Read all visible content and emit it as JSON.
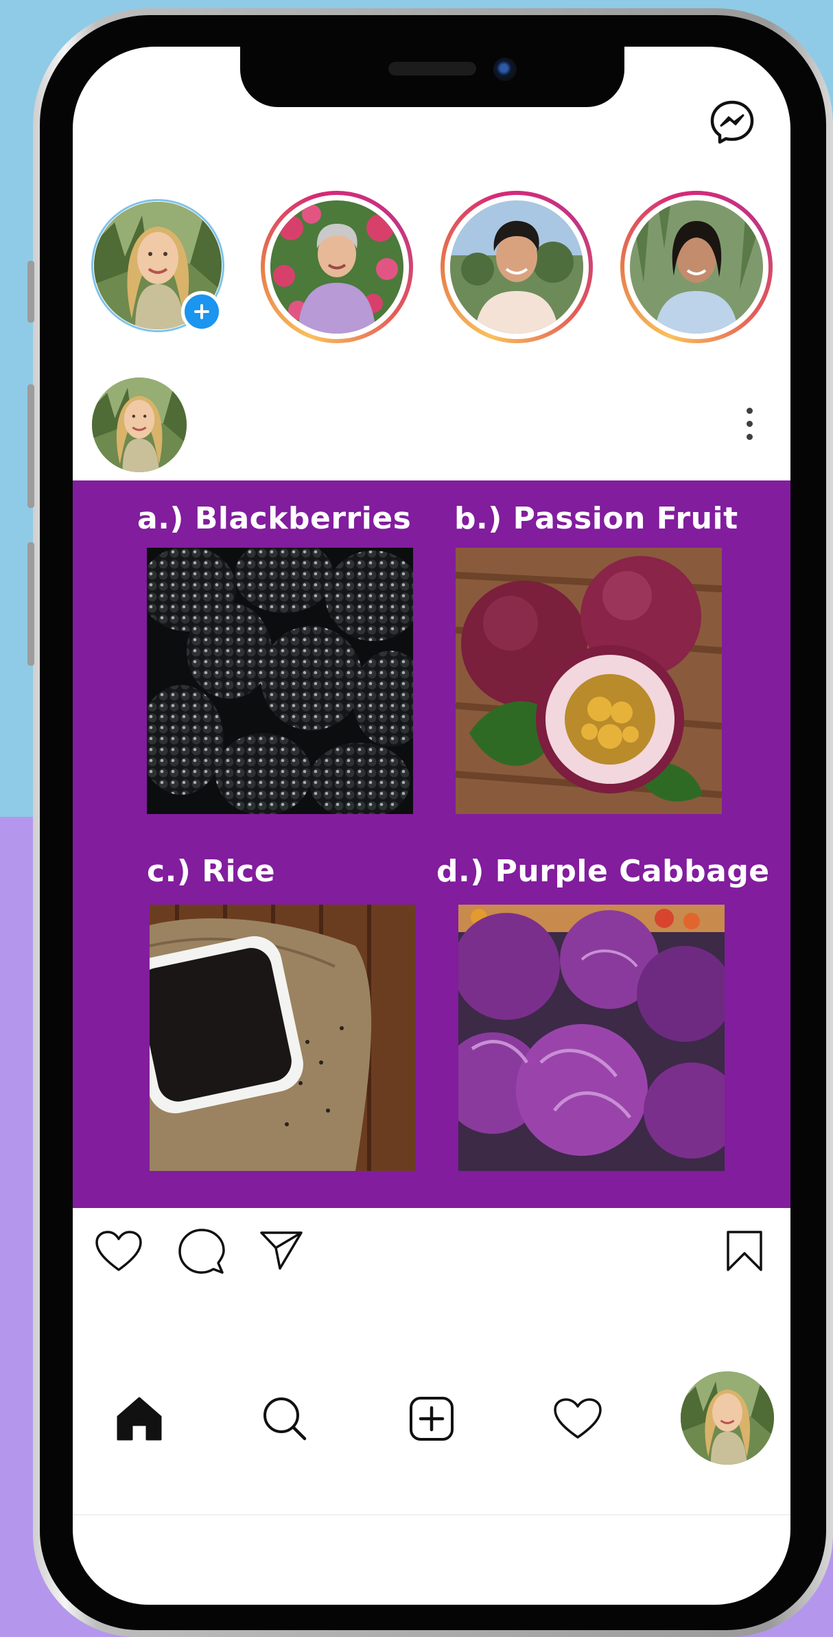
{
  "post": {
    "items": [
      {
        "label": "a.) Blackberries"
      },
      {
        "label": "b.) Passion Fruit"
      },
      {
        "label": "c.) Rice"
      },
      {
        "label": "d.) Purple Cabbage"
      }
    ]
  },
  "colors": {
    "post_background": "#821d9e",
    "background_top": "#8fcbe6",
    "background_bottom": "#b497ec",
    "add_story_badge": "#1a95f0"
  },
  "icons": {
    "header": "messenger-icon",
    "post_actions": [
      "heart-icon",
      "comment-icon",
      "send-icon",
      "bookmark-icon"
    ],
    "bottom_nav": [
      "home-icon",
      "search-icon",
      "add-post-icon",
      "activity-heart-icon",
      "profile-avatar"
    ]
  }
}
